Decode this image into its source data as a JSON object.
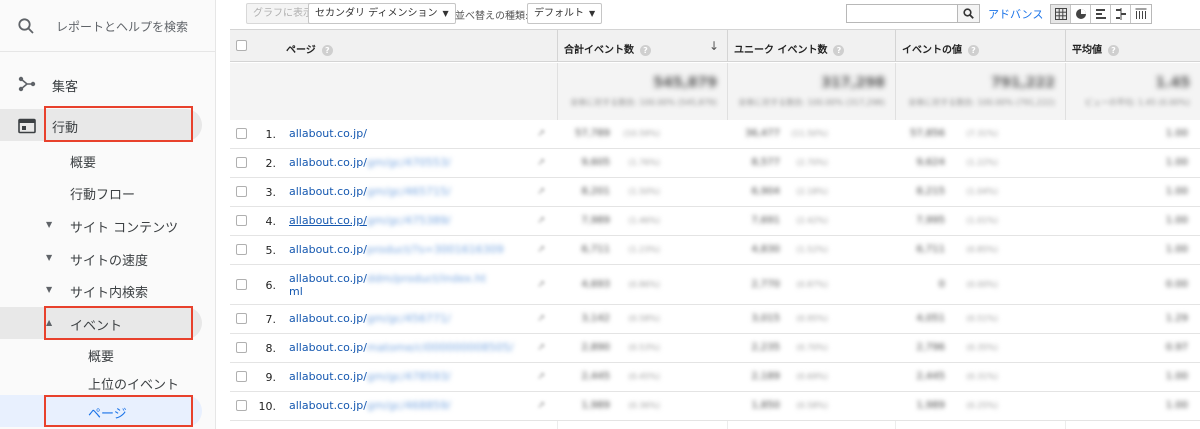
{
  "sidebar": {
    "search_label": "レポートとヘルプを検索",
    "acquisition": "集客",
    "behavior": "行動",
    "overview": "概要",
    "behavior_flow": "行動フロー",
    "site_content": "サイト コンテンツ",
    "site_speed": "サイトの速度",
    "site_search": "サイト内検索",
    "events": "イベント",
    "events_overview": "概要",
    "top_events": "上位のイベント",
    "pages": "ページ"
  },
  "toolbar": {
    "chart_button": "グラフに表示",
    "secondary_dimension": "セカンダリ ディメンション",
    "sort_type_label": "並べ替えの種類:",
    "sort_default": "デフォルト",
    "advanced_link": "アドバンス"
  },
  "table": {
    "headers": {
      "page": "ページ",
      "total_events": "合計イベント数",
      "unique_events": "ユニーク イベント数",
      "event_value": "イベントの値",
      "avg_value": "平均値"
    },
    "totals": {
      "total_events": "545,879",
      "total_events_sub": "全体に対する割合: 100.00% (545,879)",
      "unique_events": "317,298",
      "unique_events_sub": "全体に対する割合: 100.00% (317,298)",
      "event_value": "791,222",
      "event_value_sub": "全体に対する割合: 100.00% (791,222)",
      "avg_value": "1.45",
      "avg_value_sub": "ビューの平均: 1.45 (0.00%)"
    },
    "rows": [
      {
        "num": "1.",
        "host": "allabout.co.jp/",
        "path": "",
        "total": "57,789",
        "total_pct": "(10.59%)",
        "unique": "36,477",
        "unique_pct": "(11.50%)",
        "value": "57,856",
        "value_pct": "(7.31%)",
        "avg": "1.00"
      },
      {
        "num": "2.",
        "host": "allabout.co.jp/",
        "path": "gm/gc/470553/",
        "total": "9,605",
        "total_pct": "(1.76%)",
        "unique": "8,577",
        "unique_pct": "(2.70%)",
        "value": "9,624",
        "value_pct": "(1.22%)",
        "avg": "1.00"
      },
      {
        "num": "3.",
        "host": "allabout.co.jp/",
        "path": "gm/gc/465715/",
        "total": "8,201",
        "total_pct": "(1.50%)",
        "unique": "6,904",
        "unique_pct": "(2.18%)",
        "value": "8,215",
        "value_pct": "(1.04%)",
        "avg": "1.00"
      },
      {
        "num": "4.",
        "host": "allabout.co.jp/",
        "path": "gm/gc/475389/",
        "total": "7,989",
        "total_pct": "(1.46%)",
        "unique": "7,691",
        "unique_pct": "(2.42%)",
        "value": "7,995",
        "value_pct": "(1.01%)",
        "avg": "1.00"
      },
      {
        "num": "5.",
        "host": "allabout.co.jp/",
        "path": "product/?s=3001616309",
        "total": "6,711",
        "total_pct": "(1.23%)",
        "unique": "4,830",
        "unique_pct": "(1.52%)",
        "value": "6,711",
        "value_pct": "(0.85%)",
        "avg": "1.00"
      },
      {
        "num": "6.",
        "host": "allabout.co.jp/",
        "path": "ddm/product/index.ht",
        "path2": "ml",
        "total": "4,693",
        "total_pct": "(0.86%)",
        "unique": "2,770",
        "unique_pct": "(0.87%)",
        "value": "0",
        "value_pct": "(0.00%)",
        "avg": "0.00"
      },
      {
        "num": "7.",
        "host": "allabout.co.jp/",
        "path": "gm/gc/456771/",
        "total": "3,142",
        "total_pct": "(0.58%)",
        "unique": "3,015",
        "unique_pct": "(0.95%)",
        "value": "4,051",
        "value_pct": "(0.51%)",
        "avg": "1.29"
      },
      {
        "num": "8.",
        "host": "allabout.co.jp/",
        "path": "matome/cl000000008505/",
        "total": "2,890",
        "total_pct": "(0.53%)",
        "unique": "2,235",
        "unique_pct": "(0.70%)",
        "value": "2,796",
        "value_pct": "(0.35%)",
        "avg": "0.97"
      },
      {
        "num": "9.",
        "host": "allabout.co.jp/",
        "path": "gm/gc/478593/",
        "total": "2,445",
        "total_pct": "(0.45%)",
        "unique": "2,189",
        "unique_pct": "(0.69%)",
        "value": "2,445",
        "value_pct": "(0.31%)",
        "avg": "1.00"
      },
      {
        "num": "10.",
        "host": "allabout.co.jp/",
        "path": "gm/gc/468859/",
        "total": "1,989",
        "total_pct": "(0.36%)",
        "unique": "1,850",
        "unique_pct": "(0.58%)",
        "value": "1,989",
        "value_pct": "(0.25%)",
        "avg": "1.00"
      }
    ]
  },
  "colors": {
    "highlight_box": "#e8412c",
    "link": "#1558b0",
    "active_nav_bg": "#e8f0fe"
  }
}
